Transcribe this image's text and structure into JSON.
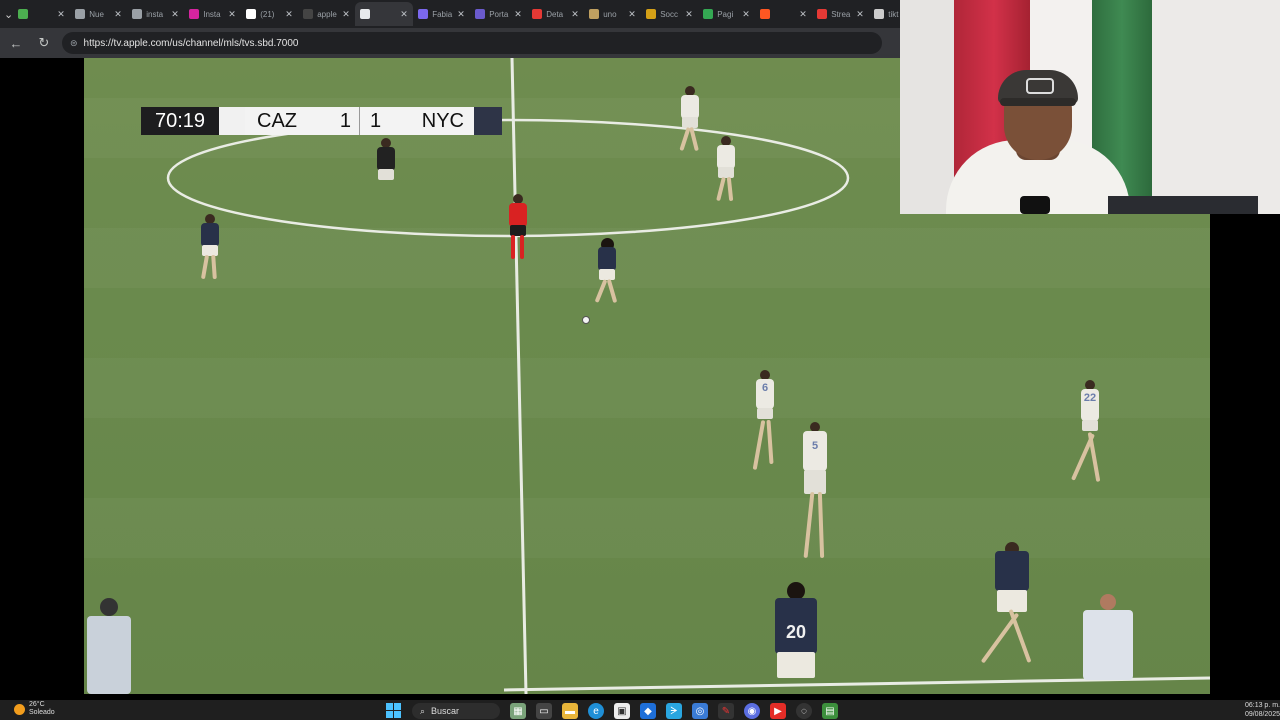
{
  "browser": {
    "tabs": [
      {
        "label": "",
        "icon": "tab-group-icon",
        "color": "#4caf50"
      },
      {
        "label": "Nue",
        "icon": "page-icon",
        "color": "#9aa0a6"
      },
      {
        "label": "insta",
        "icon": "search-icon",
        "color": "#9aa0a6"
      },
      {
        "label": "Insta",
        "icon": "instagram-icon",
        "color": "#d6249f"
      },
      {
        "label": "(21)",
        "icon": "x-icon",
        "color": "#ffffff"
      },
      {
        "label": "apple",
        "icon": "tv-icon",
        "color": "#444444"
      },
      {
        "label": "",
        "icon": "audio-icon",
        "color": "#e8eaed",
        "active": true
      },
      {
        "label": "Fabia",
        "icon": "profile-icon",
        "color": "#7b68ee"
      },
      {
        "label": "Porta",
        "icon": "portal-icon",
        "color": "#6a5acd"
      },
      {
        "label": "Deta",
        "icon": "youtube-icon",
        "color": "#e53935"
      },
      {
        "label": "uno",
        "icon": "u-icon",
        "color": "#c0a060"
      },
      {
        "label": "Socc",
        "icon": "u-icon",
        "color": "#d4a017"
      },
      {
        "label": "Pagi",
        "icon": "drive-icon",
        "color": "#34a853"
      },
      {
        "label": "",
        "icon": "media-icon",
        "color": "#ff5722"
      },
      {
        "label": "Strea",
        "icon": "stream-icon",
        "color": "#e53935"
      },
      {
        "label": "tikt",
        "icon": "tiktok-icon",
        "color": "#cccccc"
      }
    ],
    "url": "https://tv.apple.com/us/channel/mls/tvs.sbd.7000"
  },
  "scoreboard": {
    "clock": "70:19",
    "home_team": "CAZ",
    "home_score": "1",
    "away_score": "1",
    "away_team": "NYC"
  },
  "players": {
    "numbers": [
      "6",
      "5",
      "22",
      "20"
    ]
  },
  "taskbar": {
    "temperature": "26°C",
    "weather_text": "Soleado",
    "search_label": "Buscar",
    "time": "06:13 p. m.",
    "date": "09/08/2025"
  }
}
